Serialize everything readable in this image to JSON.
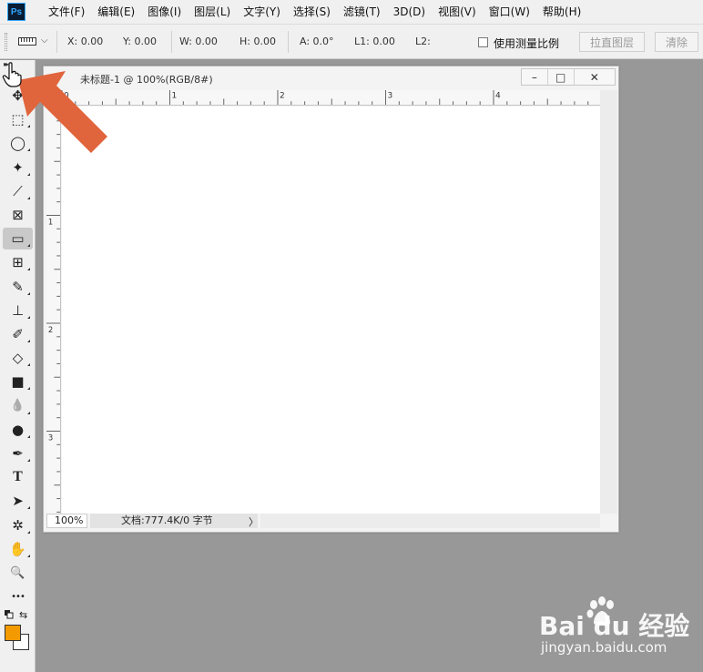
{
  "app": {
    "logo_text": "Ps"
  },
  "menu": [
    "文件(F)",
    "编辑(E)",
    "图像(I)",
    "图层(L)",
    "文字(Y)",
    "选择(S)",
    "滤镜(T)",
    "3D(D)",
    "视图(V)",
    "窗口(W)",
    "帮助(H)"
  ],
  "options": {
    "tool_icon": "ruler-icon",
    "x": "X: 0.00",
    "y": "Y: 0.00",
    "w": "W: 0.00",
    "h": "H: 0.00",
    "a": "A: 0.0°",
    "l1": "L1: 0.00",
    "l2": "L2:",
    "use_scale_label": "使用测量比例",
    "use_scale_checked": false,
    "straighten_label": "拉直图层",
    "clear_label": "清除"
  },
  "toolbar": {
    "tools": [
      {
        "name": "move-tool",
        "glyph": "✥"
      },
      {
        "name": "marquee-tool",
        "glyph": "⬚"
      },
      {
        "name": "lasso-tool",
        "glyph": "◯"
      },
      {
        "name": "magic-wand-tool",
        "glyph": "✦"
      },
      {
        "name": "crop-tool",
        "glyph": "⟋"
      },
      {
        "name": "frame-tool",
        "glyph": "⊠"
      },
      {
        "name": "ruler-tool",
        "glyph": "▭",
        "active": true
      },
      {
        "name": "patch-tool",
        "glyph": "⊞"
      },
      {
        "name": "brush-tool",
        "glyph": "✎"
      },
      {
        "name": "clone-stamp-tool",
        "glyph": "⊥"
      },
      {
        "name": "history-brush-tool",
        "glyph": "✐"
      },
      {
        "name": "eraser-tool",
        "glyph": "◇"
      },
      {
        "name": "gradient-tool",
        "glyph": "■"
      },
      {
        "name": "blur-tool",
        "glyph": "💧"
      },
      {
        "name": "dodge-tool",
        "glyph": "●"
      },
      {
        "name": "pen-tool",
        "glyph": "✒"
      },
      {
        "name": "type-tool",
        "glyph": "T"
      },
      {
        "name": "path-selection-tool",
        "glyph": "➤"
      },
      {
        "name": "shape-tool",
        "glyph": "✲"
      },
      {
        "name": "hand-tool",
        "glyph": "✋"
      },
      {
        "name": "zoom-tool",
        "glyph": "🔍"
      },
      {
        "name": "more-tools",
        "glyph": "•••"
      }
    ],
    "foreground_color": "#f39a00",
    "background_color": "#ffffff"
  },
  "document": {
    "title": "未标题-1 @ 100%(RGB/8#)",
    "minimize": "–",
    "maximize": "□",
    "close": "✕",
    "ruler_top_labels": [
      "0",
      "1",
      "2",
      "3",
      "4"
    ],
    "ruler_left_labels": [
      "1",
      "2",
      "3"
    ],
    "zoom": "100%",
    "info": "文档:777.4K/0 字节",
    "info_arrow": "〉"
  },
  "watermark": {
    "brand": "Bai du 经验",
    "url": "jingyan.baidu.com"
  },
  "colors": {
    "annotation_arrow": "#e0643c",
    "workspace_bg": "#989898",
    "panel_bg": "#f0f0f0"
  }
}
